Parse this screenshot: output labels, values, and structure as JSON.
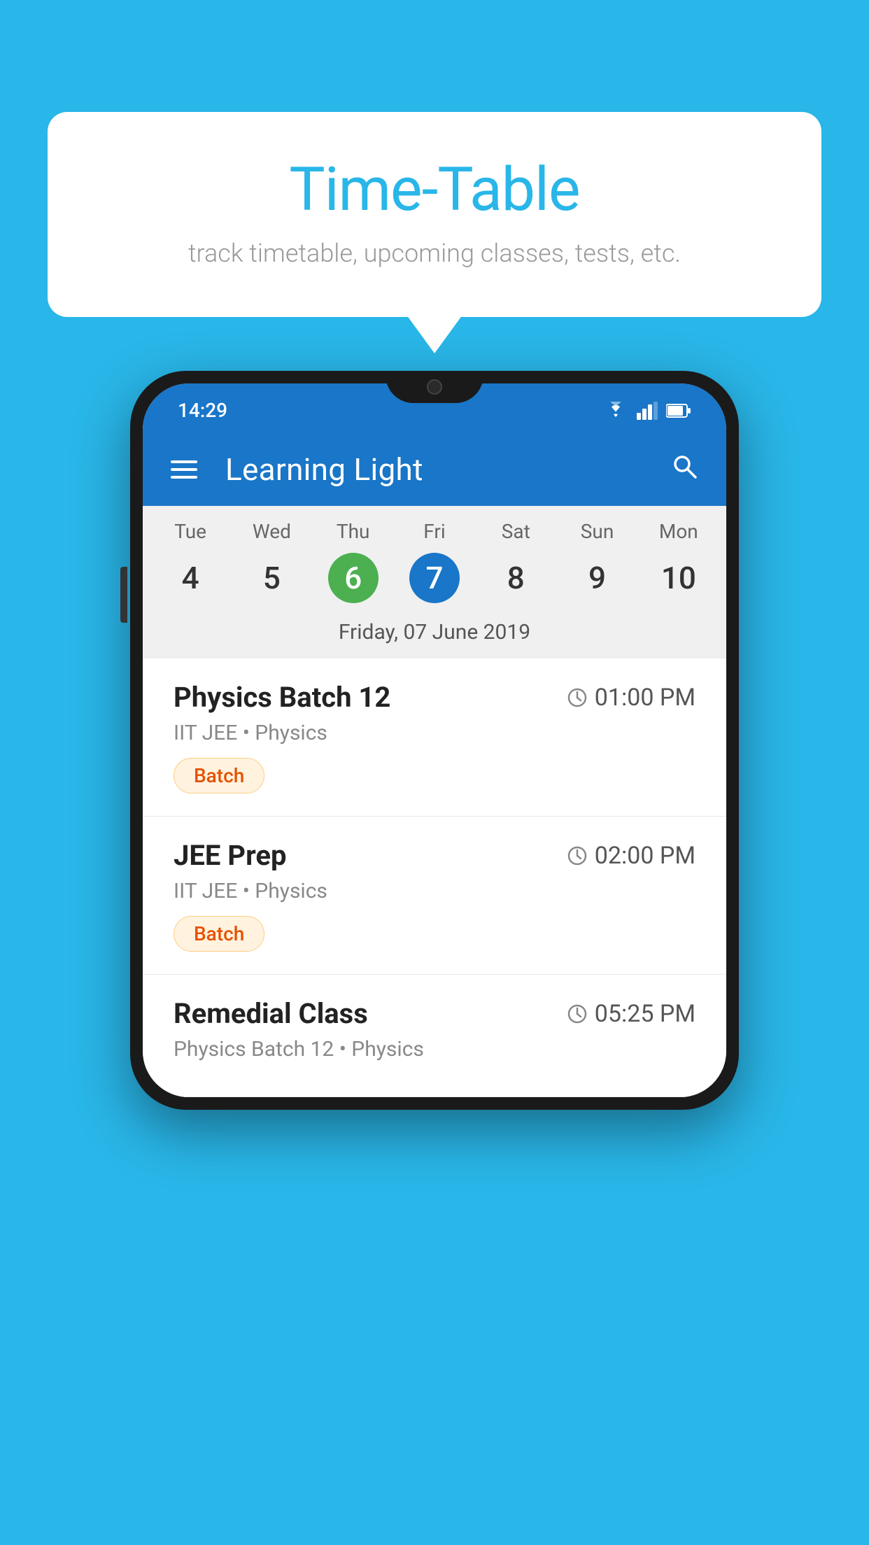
{
  "background_color": "#29B6E8",
  "speech_bubble": {
    "title": "Time-Table",
    "subtitle": "track timetable, upcoming classes, tests, etc."
  },
  "status_bar": {
    "time": "14:29",
    "icons": [
      "wifi",
      "signal",
      "battery"
    ]
  },
  "app_header": {
    "title": "Learning Light",
    "icons": {
      "menu": "hamburger-menu",
      "search": "search"
    }
  },
  "calendar": {
    "days": [
      {
        "name": "Tue",
        "num": "4",
        "state": "normal"
      },
      {
        "name": "Wed",
        "num": "5",
        "state": "normal"
      },
      {
        "name": "Thu",
        "num": "6",
        "state": "today"
      },
      {
        "name": "Fri",
        "num": "7",
        "state": "selected"
      },
      {
        "name": "Sat",
        "num": "8",
        "state": "normal"
      },
      {
        "name": "Sun",
        "num": "9",
        "state": "normal"
      },
      {
        "name": "Mon",
        "num": "10",
        "state": "normal"
      }
    ],
    "selected_date_label": "Friday, 07 June 2019"
  },
  "classes": [
    {
      "name": "Physics Batch 12",
      "time": "01:00 PM",
      "subject": "IIT JEE • Physics",
      "tag": "Batch"
    },
    {
      "name": "JEE Prep",
      "time": "02:00 PM",
      "subject": "IIT JEE • Physics",
      "tag": "Batch"
    },
    {
      "name": "Remedial Class",
      "time": "05:25 PM",
      "subject": "Physics Batch 12 • Physics",
      "tag": ""
    }
  ]
}
